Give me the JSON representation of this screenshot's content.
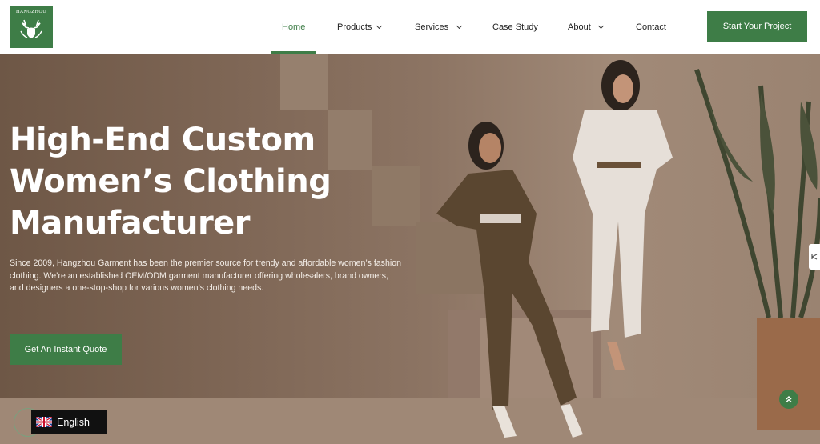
{
  "brand": {
    "logo_text": "HANGZHOU"
  },
  "nav": {
    "items": [
      {
        "label": "Home",
        "active": true
      },
      {
        "label": "Products",
        "dropdown": true
      },
      {
        "label": "Services",
        "dropdown": true
      },
      {
        "label": "Case Study"
      },
      {
        "label": "About",
        "dropdown": true
      },
      {
        "label": "Contact"
      }
    ],
    "cta_label": "Start Your Project"
  },
  "hero": {
    "title": "High-End Custom Women’s Clothing Manufacturer",
    "description": "Since 2009, Hangzhou Garment has been the premier source for trendy and affordable women’s fashion clothing. We’re an established OEM/ODM garment manufacturer offering wholesalers, brand owners, and designers a one-stop-shop for various women’s clothing needs.",
    "cta_label": "Get An Instant Quote"
  },
  "language": {
    "label": "English",
    "flag": "uk-flag-icon"
  },
  "colors": {
    "accent": "#3e7d47",
    "hero_overlay": "#7e6655"
  }
}
